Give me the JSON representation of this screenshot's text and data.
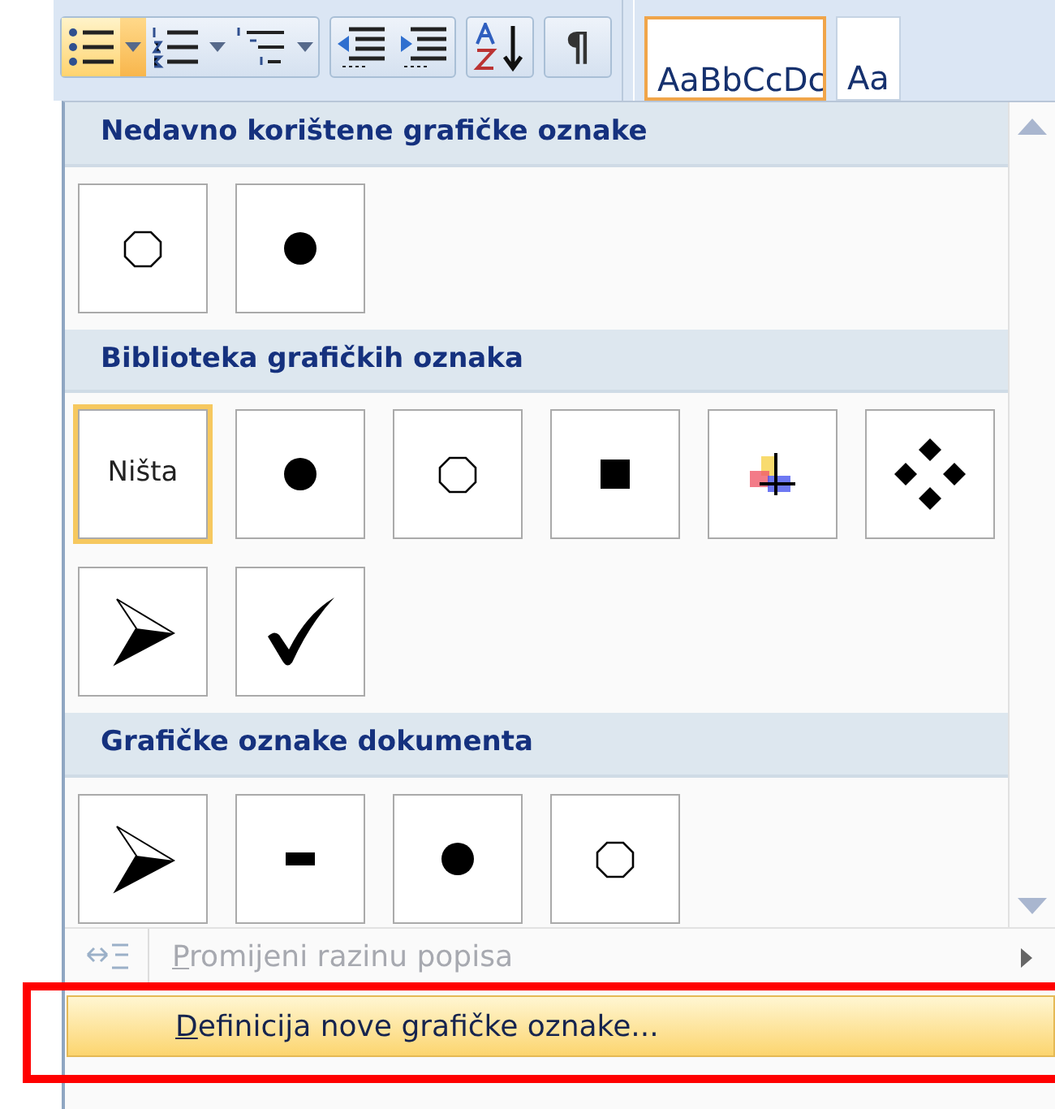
{
  "toolbar": {
    "buttons": [
      {
        "kind": "bullets",
        "active": true,
        "has_caret": true
      },
      {
        "kind": "numbering",
        "active": false,
        "has_caret": true
      },
      {
        "kind": "multilevel",
        "active": false,
        "has_caret": true
      },
      {
        "kind": "outdent",
        "active": false
      },
      {
        "kind": "indent",
        "active": false
      },
      {
        "kind": "sort",
        "active": false
      },
      {
        "kind": "pilcrow",
        "label": "¶",
        "active": false
      }
    ],
    "styles": [
      {
        "label": "AaBbCcDc",
        "selected": true
      },
      {
        "label": "Aa",
        "selected": false
      }
    ]
  },
  "sections": [
    {
      "title": "Nedavno korištene grafičke oznake",
      "bullets": [
        {
          "kind": "hollow-circle",
          "selected": false
        },
        {
          "kind": "dot",
          "selected": false
        }
      ]
    },
    {
      "title": "Biblioteka grafičkih oznaka",
      "bullets": [
        {
          "kind": "none",
          "label": "Ništa",
          "selected": true
        },
        {
          "kind": "dot",
          "selected": false
        },
        {
          "kind": "hollow-circle",
          "selected": false
        },
        {
          "kind": "square",
          "selected": false
        },
        {
          "kind": "color-cross",
          "selected": false
        },
        {
          "kind": "diamonds",
          "selected": false
        },
        {
          "kind": "arrow",
          "selected": false
        },
        {
          "kind": "check",
          "selected": false
        }
      ]
    },
    {
      "title": "Grafičke oznake dokumenta",
      "bullets": [
        {
          "kind": "arrow",
          "selected": false
        },
        {
          "kind": "dash",
          "selected": false
        },
        {
          "kind": "dot",
          "selected": false
        },
        {
          "kind": "hollow-circle",
          "selected": false
        }
      ]
    }
  ],
  "menu_items": [
    {
      "label": "Promijeni razinu popisa",
      "underline_first": true,
      "disabled": true,
      "submenu": true,
      "icon": true,
      "hovered": false
    },
    {
      "label": "Definicija nove grafičke oznake...",
      "underline_first": true,
      "disabled": false,
      "hovered": true,
      "highlighted": true
    }
  ]
}
